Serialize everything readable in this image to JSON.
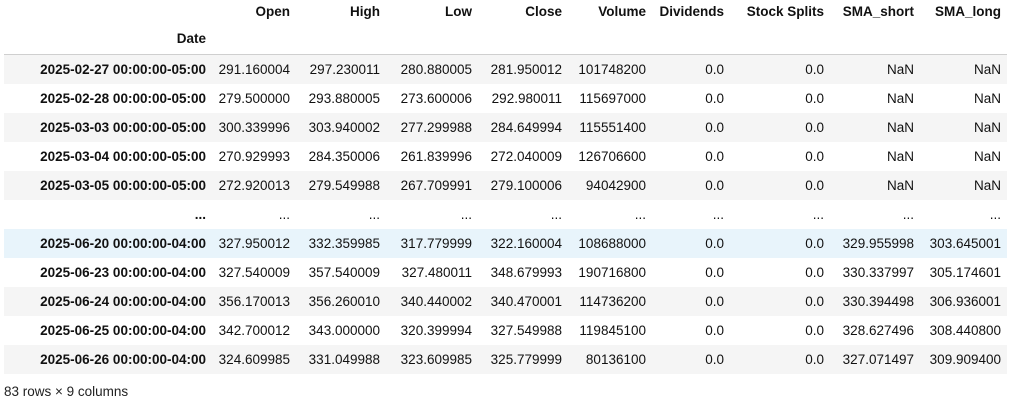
{
  "index_name": "Date",
  "columns": [
    "Open",
    "High",
    "Low",
    "Close",
    "Volume",
    "Dividends",
    "Stock Splits",
    "SMA_short",
    "SMA_long"
  ],
  "rows": [
    {
      "idx": "2025-02-27 00:00:00-05:00",
      "cells": [
        "291.160004",
        "297.230011",
        "280.880005",
        "281.950012",
        "101748200",
        "0.0",
        "0.0",
        "NaN",
        "NaN"
      ]
    },
    {
      "idx": "2025-02-28 00:00:00-05:00",
      "cells": [
        "279.500000",
        "293.880005",
        "273.600006",
        "292.980011",
        "115697000",
        "0.0",
        "0.0",
        "NaN",
        "NaN"
      ]
    },
    {
      "idx": "2025-03-03 00:00:00-05:00",
      "cells": [
        "300.339996",
        "303.940002",
        "277.299988",
        "284.649994",
        "115551400",
        "0.0",
        "0.0",
        "NaN",
        "NaN"
      ]
    },
    {
      "idx": "2025-03-04 00:00:00-05:00",
      "cells": [
        "270.929993",
        "284.350006",
        "261.839996",
        "272.040009",
        "126706600",
        "0.0",
        "0.0",
        "NaN",
        "NaN"
      ]
    },
    {
      "idx": "2025-03-05 00:00:00-05:00",
      "cells": [
        "272.920013",
        "279.549988",
        "267.709991",
        "279.100006",
        "94042900",
        "0.0",
        "0.0",
        "NaN",
        "NaN"
      ]
    },
    {
      "idx": "...",
      "cells": [
        "...",
        "...",
        "...",
        "...",
        "...",
        "...",
        "...",
        "...",
        "..."
      ]
    },
    {
      "idx": "2025-06-20 00:00:00-04:00",
      "cells": [
        "327.950012",
        "332.359985",
        "317.779999",
        "322.160004",
        "108688000",
        "0.0",
        "0.0",
        "329.955998",
        "303.645001"
      ]
    },
    {
      "idx": "2025-06-23 00:00:00-04:00",
      "cells": [
        "327.540009",
        "357.540009",
        "327.480011",
        "348.679993",
        "190716800",
        "0.0",
        "0.0",
        "330.337997",
        "305.174601"
      ]
    },
    {
      "idx": "2025-06-24 00:00:00-04:00",
      "cells": [
        "356.170013",
        "356.260010",
        "340.440002",
        "340.470001",
        "114736200",
        "0.0",
        "0.0",
        "330.394498",
        "306.936001"
      ]
    },
    {
      "idx": "2025-06-25 00:00:00-04:00",
      "cells": [
        "342.700012",
        "343.000000",
        "320.399994",
        "327.549988",
        "119845100",
        "0.0",
        "0.0",
        "328.627496",
        "308.440800"
      ]
    },
    {
      "idx": "2025-06-26 00:00:00-04:00",
      "cells": [
        "324.609985",
        "331.049988",
        "323.609985",
        "325.779999",
        "80136100",
        "0.0",
        "0.0",
        "327.071497",
        "309.909400"
      ]
    }
  ],
  "footer": "83 rows × 9 columns"
}
